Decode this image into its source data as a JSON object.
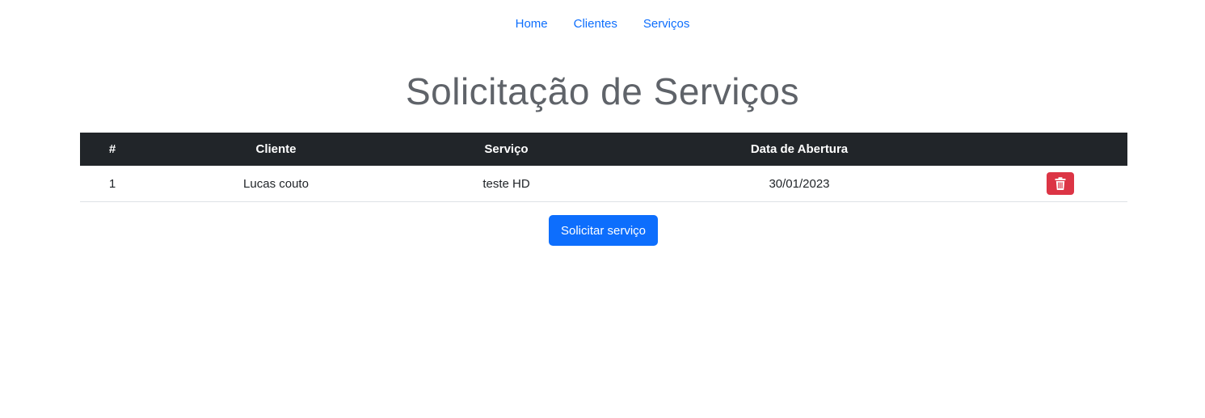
{
  "nav": {
    "items": [
      {
        "label": "Home"
      },
      {
        "label": "Clientes"
      },
      {
        "label": "Serviços"
      }
    ]
  },
  "page": {
    "title": "Solicitação de Serviços"
  },
  "table": {
    "headers": [
      "#",
      "Cliente",
      "Serviço",
      "Data de Abertura",
      ""
    ],
    "rows": [
      {
        "id": "1",
        "cliente": "Lucas couto",
        "servico": "teste HD",
        "data": "30/01/2023",
        "action_icon": "trash-icon"
      }
    ]
  },
  "actions": {
    "request_label": "Solicitar serviço"
  },
  "colors": {
    "link": "#0d6efd",
    "primary": "#0d6efd",
    "danger": "#dc3545",
    "table_header": "#212529"
  }
}
